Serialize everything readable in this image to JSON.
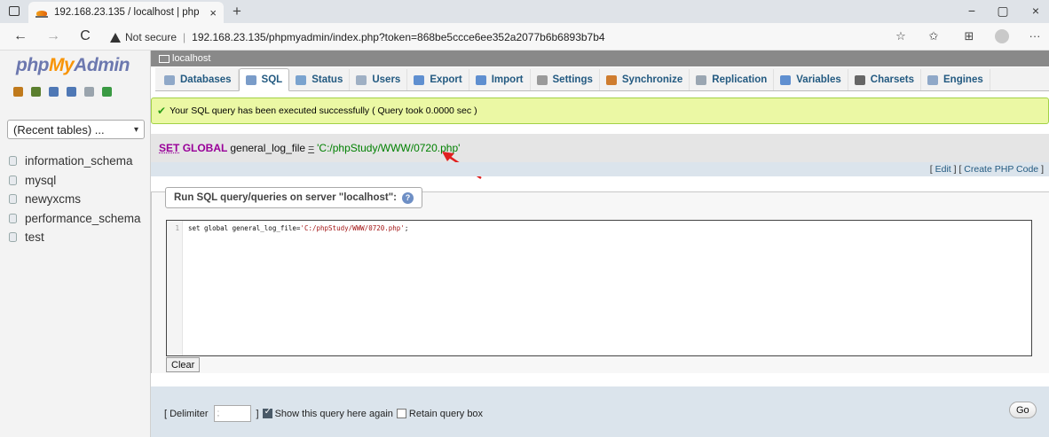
{
  "browser": {
    "tab_title": "192.168.23.135 / localhost | php",
    "tab_close": "×",
    "new_tab": "+",
    "minimize": "−",
    "maximize": "▢",
    "close": "×",
    "back": "←",
    "forward": "→",
    "reload": "C",
    "security_label": "Not secure",
    "url": "192.168.23.135/phpmyadmin/index.php?token=868be5ccce6ee352a2077b6b6893b7b4",
    "icons": [
      "read-aloud-icon",
      "favorites-icon",
      "collections-icon",
      "profile-icon",
      "more-icon"
    ]
  },
  "left_panel": {
    "logo": {
      "php": "php",
      "my": "My",
      "admin": "Admin"
    },
    "quick_icons": [
      {
        "name": "home-icon",
        "color": "#c07a1c"
      },
      {
        "name": "tables-icon",
        "color": "#5b7f2f"
      },
      {
        "name": "sql-icon",
        "color": "#4f78b5"
      },
      {
        "name": "docs-icon",
        "color": "#4f78b5"
      },
      {
        "name": "page-icon",
        "color": "#9aa4ad"
      },
      {
        "name": "reload-icon",
        "color": "#3a9a43"
      }
    ],
    "recent_tables": "(Recent tables) ...",
    "databases": [
      "information_schema",
      "mysql",
      "newyxcms",
      "performance_schema",
      "test"
    ]
  },
  "main": {
    "server_label": "localhost",
    "tabs": [
      {
        "label": "Databases",
        "icon": "databases-icon",
        "color": "#8fa8c8"
      },
      {
        "label": "SQL",
        "icon": "sql-icon",
        "color": "#7a9cc9",
        "active": true
      },
      {
        "label": "Status",
        "icon": "status-icon",
        "color": "#7aa3cf"
      },
      {
        "label": "Users",
        "icon": "users-icon",
        "color": "#9fb0c4"
      },
      {
        "label": "Export",
        "icon": "export-icon",
        "color": "#5f8fd0"
      },
      {
        "label": "Import",
        "icon": "import-icon",
        "color": "#5f8fd0"
      },
      {
        "label": "Settings",
        "icon": "settings-icon",
        "color": "#9a9a9a"
      },
      {
        "label": "Synchronize",
        "icon": "synchronize-icon",
        "color": "#cf7d2f"
      },
      {
        "label": "Replication",
        "icon": "replication-icon",
        "color": "#9aa6b2"
      },
      {
        "label": "Variables",
        "icon": "variables-icon",
        "color": "#5f8fd0"
      },
      {
        "label": "Charsets",
        "icon": "charsets-icon",
        "color": "#666666"
      },
      {
        "label": "Engines",
        "icon": "engines-icon",
        "color": "#8fa8c8"
      }
    ],
    "success_message": "Your SQL query has been executed successfully ( Query took 0.0000 sec )",
    "executed_sql": {
      "kw1": "SET",
      "kw2": "GLOBAL",
      "ident": "general_log_file",
      "op": "=",
      "value": "'C:/phpStudy/WWW/0720.php'"
    },
    "links": {
      "edit": "Edit",
      "create_php": "Create PHP Code"
    },
    "query_legend": "Run SQL query/queries on server \"localhost\":",
    "editor": {
      "line_number": "1",
      "code_prefix": "set global general_log_file=",
      "code_string": "'C:/phpStudy/WWW/0720.php'",
      "code_suffix": ";"
    },
    "clear_label": "Clear",
    "delimiter_label": "[ Delimiter",
    "delimiter_value": ";",
    "delimiter_close": "]",
    "show_again_label": "Show this query here again",
    "retain_label": "Retain query box",
    "go_label": "Go"
  }
}
